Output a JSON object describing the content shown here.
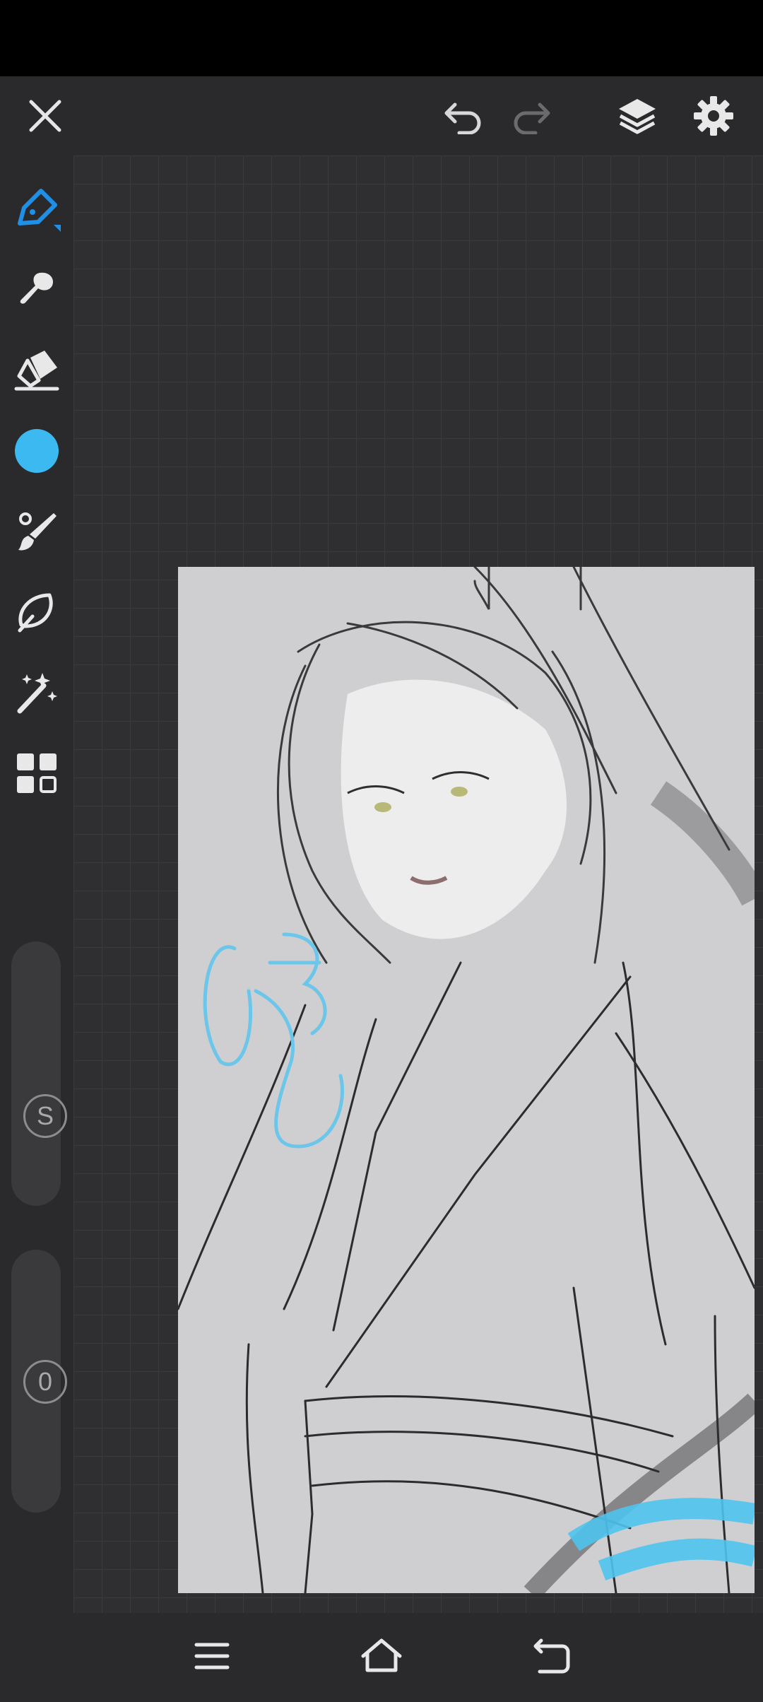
{
  "app": {
    "toolbar": {
      "close": "close-icon",
      "undo": "undo-icon",
      "redo": "redo-icon",
      "layers": "layers-icon",
      "settings": "gear-icon"
    },
    "tools": [
      {
        "id": "pen",
        "icon": "pen-icon",
        "active": true
      },
      {
        "id": "smudge",
        "icon": "smudge-icon"
      },
      {
        "id": "eraser",
        "icon": "eraser-icon"
      },
      {
        "id": "color",
        "icon": "color-swatch",
        "color": "#3bb9f0"
      },
      {
        "id": "brush",
        "icon": "brush-icon"
      },
      {
        "id": "lasso",
        "icon": "lasso-icon"
      },
      {
        "id": "magic",
        "icon": "magic-wand-icon"
      },
      {
        "id": "grid",
        "icon": "grid-icon"
      }
    ],
    "sliders": {
      "size_label": "S",
      "opacity_label": "0"
    },
    "nav": [
      "menu-icon",
      "home-icon",
      "back-icon"
    ],
    "colors": {
      "accent": "#1e90e8",
      "swatch": "#3bb9f0"
    }
  }
}
